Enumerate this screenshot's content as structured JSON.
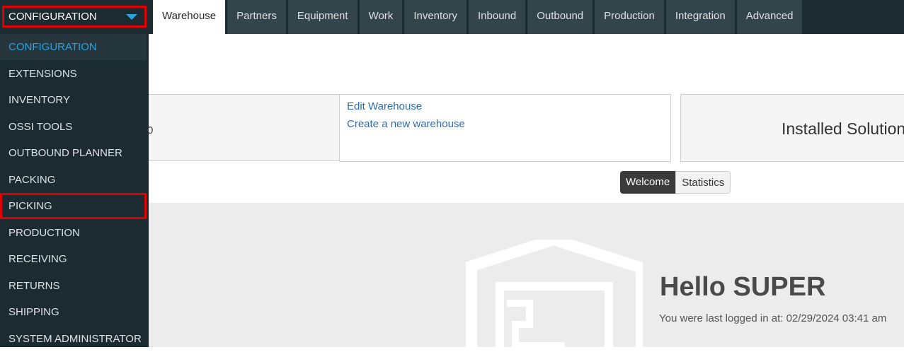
{
  "module_select": {
    "value": "CONFIGURATION"
  },
  "tabs": [
    {
      "label": "Warehouse",
      "active": true
    },
    {
      "label": "Partners"
    },
    {
      "label": "Equipment"
    },
    {
      "label": "Work"
    },
    {
      "label": "Inventory"
    },
    {
      "label": "Inbound"
    },
    {
      "label": "Outbound"
    },
    {
      "label": "Production"
    },
    {
      "label": "Integration"
    },
    {
      "label": "Advanced"
    }
  ],
  "sidebar": {
    "items": [
      {
        "label": "CONFIGURATION"
      },
      {
        "label": "EXTENSIONS"
      },
      {
        "label": "INVENTORY"
      },
      {
        "label": "OSSI TOOLS"
      },
      {
        "label": "OUTBOUND PLANNER"
      },
      {
        "label": "PACKING"
      },
      {
        "label": "PICKING"
      },
      {
        "label": "PRODUCTION"
      },
      {
        "label": "RECEIVING"
      },
      {
        "label": "RETURNS"
      },
      {
        "label": "SHIPPING"
      },
      {
        "label": "SYSTEM ADMINISTRATOR"
      }
    ]
  },
  "warehouse_panel": {
    "fragment": "0"
  },
  "links": {
    "edit": "Edit Warehouse",
    "create": "Create a new warehouse"
  },
  "installed": {
    "title": "Installed Solutions"
  },
  "view_toggle": {
    "welcome": "Welcome",
    "statistics": "Statistics"
  },
  "welcome": {
    "greeting": "Hello SUPER",
    "last_login": "You were last logged in at: 02/29/2024 03:41 am"
  },
  "colors": {
    "dark_bg": "#1c2b31",
    "tab_bg": "#34444b",
    "accent": "#29a3e0",
    "highlight": "#e00000",
    "link": "#2a6db5"
  }
}
